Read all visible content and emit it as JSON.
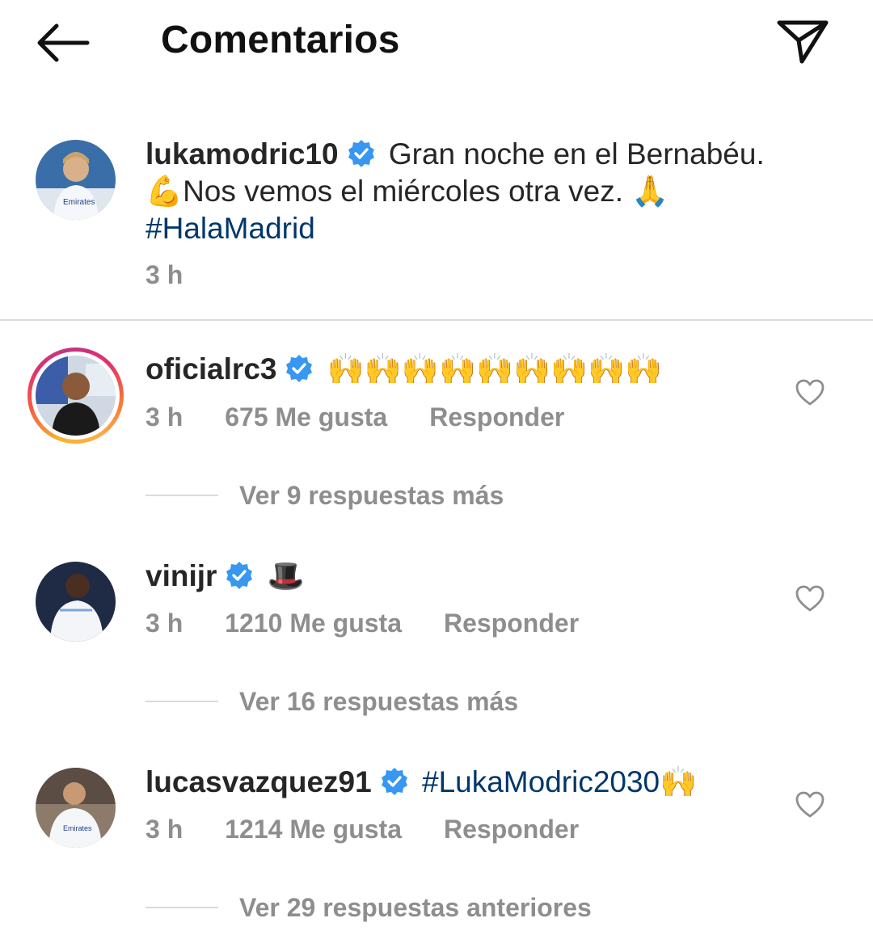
{
  "header": {
    "title": "Comentarios",
    "back_icon": "arrow-left-icon",
    "send_icon": "paper-plane-icon"
  },
  "caption": {
    "username": "lukamodric10",
    "line1": "Gran noche en el Bernabéu.",
    "line2_emoji": "💪",
    "line2": "Nos vemos el miércoles otra vez. ",
    "line2_end_emoji": "🙏",
    "hashtag": "#HalaMadrid",
    "time": "3 h"
  },
  "comments": [
    {
      "username": "oficialrc3",
      "text": "🙌🙌🙌🙌🙌🙌🙌🙌🙌",
      "time": "3 h",
      "likes": "675 Me gusta",
      "reply": "Responder",
      "view_replies": "Ver 9 respuestas más",
      "has_story": true
    },
    {
      "username": "vinijr",
      "text": "🎩",
      "time": "3 h",
      "likes": "1210 Me gusta",
      "reply": "Responder",
      "view_replies": "Ver 16 respuestas más"
    },
    {
      "username": "lucasvazquez91",
      "hashtag": "#LukaModric2030",
      "text": "🙌",
      "time": "3 h",
      "likes": "1214 Me gusta",
      "reply": "Responder",
      "view_replies": "Ver 29 respuestas anteriores"
    }
  ],
  "colors": {
    "verified": "#3897f0",
    "hashtag": "#00376b",
    "secondary_text": "#8e8e8e",
    "divider": "#dbdbdb"
  }
}
